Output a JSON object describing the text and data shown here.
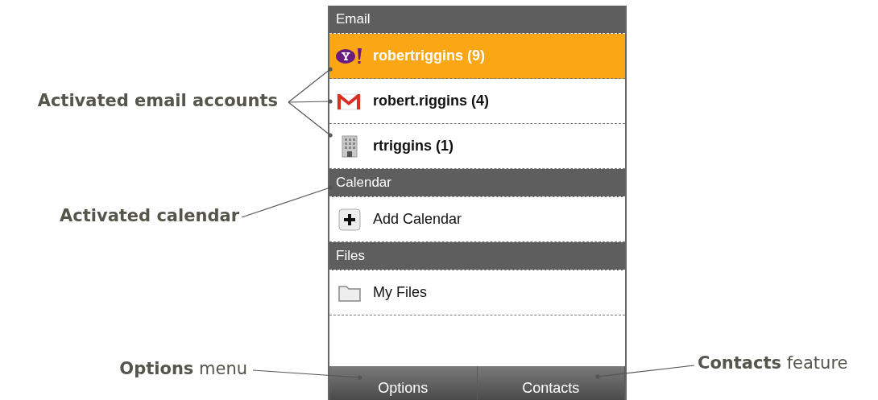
{
  "sections": [
    {
      "title": "Email",
      "items": [
        {
          "kind": "yahoo",
          "label": "robertriggins (9)",
          "selected": true
        },
        {
          "kind": "gmail",
          "label": "robert.riggins (4)",
          "selected": false
        },
        {
          "kind": "exchange",
          "label": "rtriggins (1)",
          "selected": false
        }
      ]
    },
    {
      "title": "Calendar",
      "items": [
        {
          "kind": "add",
          "label": "Add Calendar",
          "selected": false
        }
      ]
    },
    {
      "title": "Files",
      "items": [
        {
          "kind": "folder",
          "label": "My Files",
          "selected": false
        }
      ]
    }
  ],
  "softkeys": [
    "Options",
    "Contacts"
  ],
  "callouts": [
    {
      "text": "Activated email accounts"
    },
    {
      "text": "Activated calendar"
    },
    {
      "text": "**Options** menu"
    },
    {
      "text": "**Contacts** feature"
    }
  ]
}
